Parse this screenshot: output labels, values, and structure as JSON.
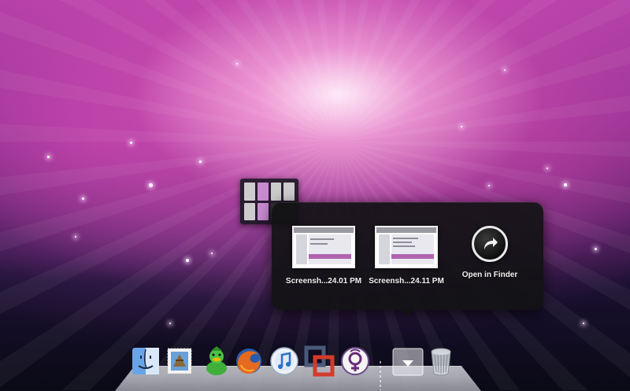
{
  "popover": {
    "items": [
      {
        "label": "Screensh...24.01 PM",
        "icon": "screenshot-thumbnail"
      },
      {
        "label": "Screensh...24.11 PM",
        "icon": "screenshot-thumbnail"
      },
      {
        "label": "Open in Finder",
        "icon": "arrow-circle-icon"
      }
    ]
  },
  "dock": {
    "items": [
      {
        "name": "finder",
        "icon": "finder-icon"
      },
      {
        "name": "mail",
        "icon": "mail-stamp-icon"
      },
      {
        "name": "adium",
        "icon": "duck-icon"
      },
      {
        "name": "firefox",
        "icon": "firefox-icon"
      },
      {
        "name": "itunes",
        "icon": "itunes-icon"
      },
      {
        "name": "parallels",
        "icon": "parallels-icon"
      },
      {
        "name": "venus-app",
        "icon": "venus-symbol-icon"
      },
      {
        "name": "screenshots-stack",
        "icon": "stack-arrow-icon"
      },
      {
        "name": "trash",
        "icon": "trash-icon"
      }
    ]
  },
  "colors": {
    "popover_bg": "#121214",
    "wallpaper_pink": "#b33fa7",
    "label_text": "#f2f2f2"
  }
}
